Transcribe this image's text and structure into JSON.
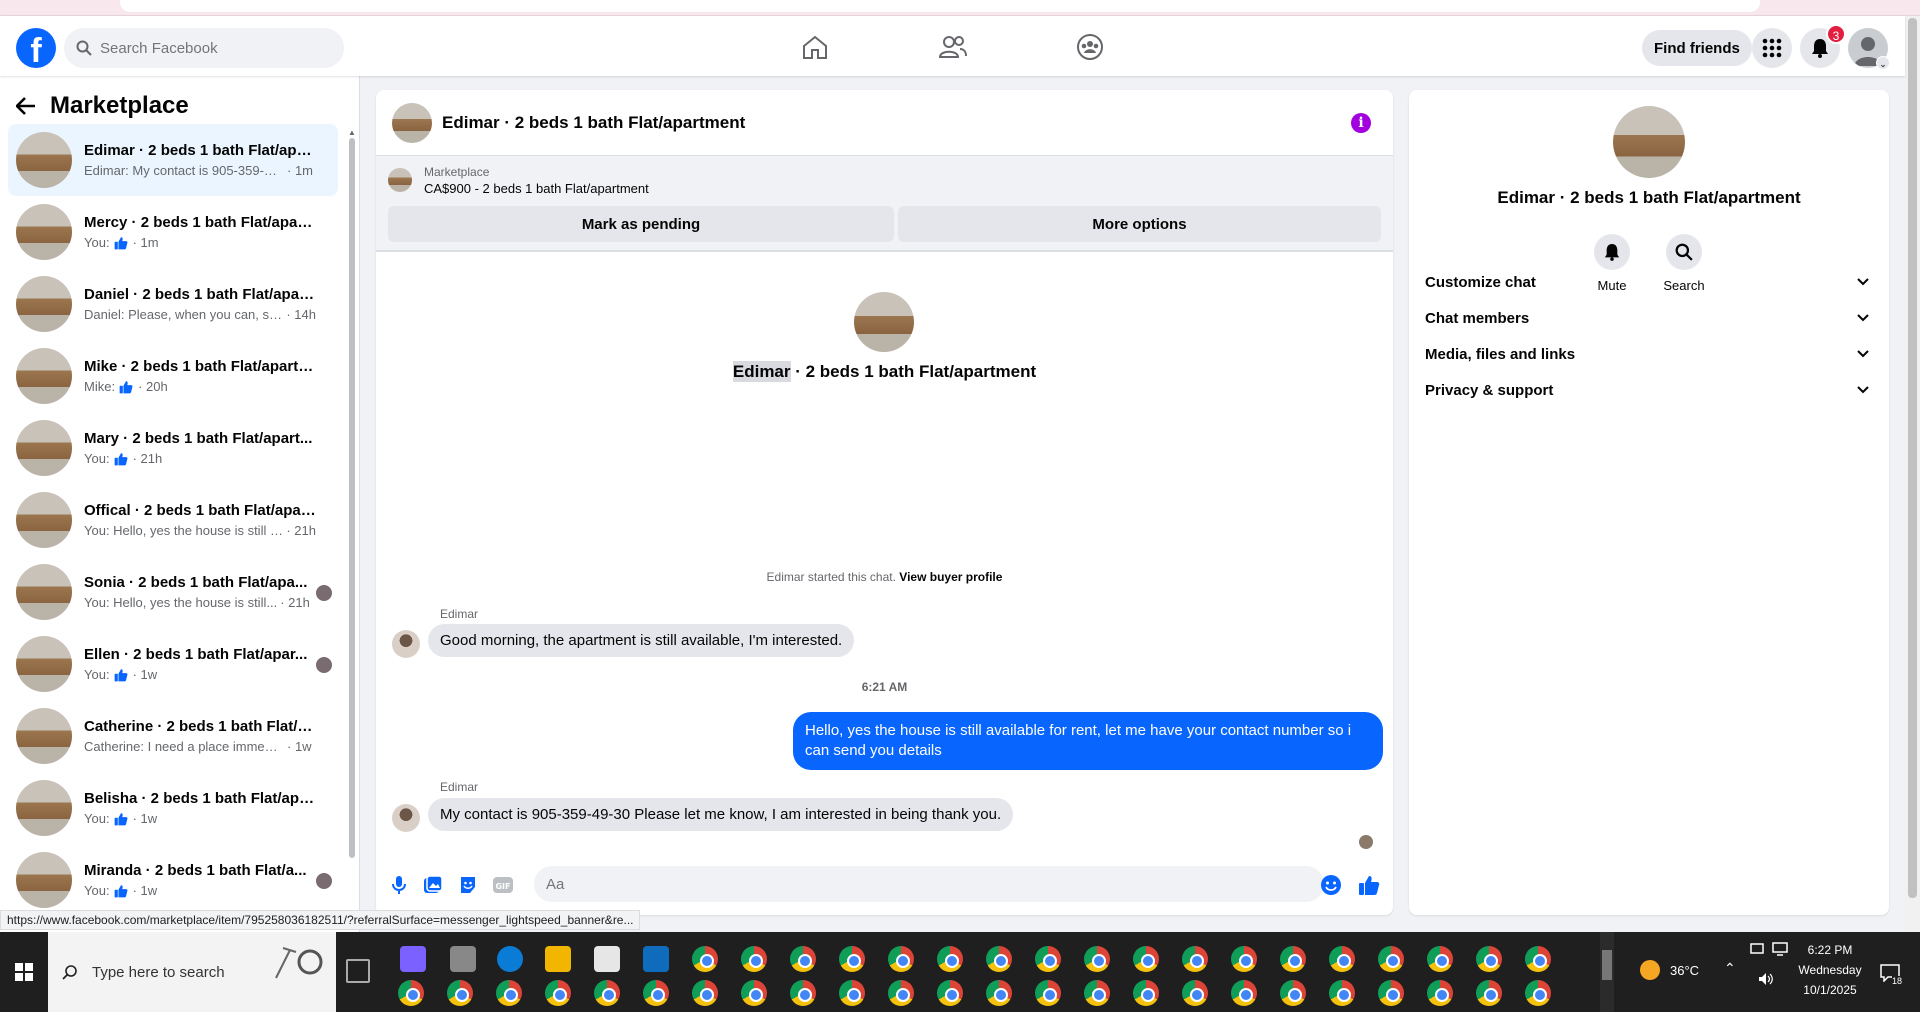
{
  "header": {
    "search_placeholder": "Search Facebook",
    "find_friends": "Find friends",
    "notifications_count": "3",
    "logo_letter": "f"
  },
  "sidebar": {
    "title": "Marketplace",
    "conversations": [
      {
        "title": "Edimar · 2 beds 1 bath Flat/apart...",
        "preview": "Edimar: My contact is 905-359-49-...",
        "time": "· 1m",
        "like": false,
        "active": true,
        "avatar": false
      },
      {
        "title": "Mercy · 2 beds 1 bath Flat/apart...",
        "preview": "You:",
        "time": "· 1m",
        "like": true,
        "active": false,
        "avatar": false
      },
      {
        "title": "Daniel · 2 beds 1 bath Flat/apart...",
        "preview": "Daniel: Please, when you can, sen...",
        "time": "· 14h",
        "like": false,
        "active": false,
        "avatar": false
      },
      {
        "title": "Mike · 2 beds 1 bath Flat/apartm...",
        "preview": "Mike:",
        "time": "· 20h",
        "like": true,
        "active": false,
        "avatar": false
      },
      {
        "title": "Mary · 2 beds 1 bath Flat/apart...",
        "preview": "You:",
        "time": "· 21h",
        "like": true,
        "active": false,
        "avatar": false
      },
      {
        "title": "Offical · 2 beds 1 bath Flat/apart...",
        "preview": "You: Hello, yes the house is still av...",
        "time": "· 21h",
        "like": false,
        "active": false,
        "avatar": false
      },
      {
        "title": "Sonia · 2 beds 1 bath Flat/apa...",
        "preview": "You: Hello, yes the house is still...",
        "time": "· 21h",
        "like": false,
        "active": false,
        "avatar": true
      },
      {
        "title": "Ellen · 2 beds 1 bath Flat/apar...",
        "preview": "You:",
        "time": "· 1w",
        "like": true,
        "active": false,
        "avatar": true
      },
      {
        "title": "Catherine · 2 beds 1 bath Flat/ap...",
        "preview": "Catherine: I need a place immediate",
        "time": "· 1w",
        "like": false,
        "active": false,
        "avatar": false
      },
      {
        "title": "Belisha · 2 beds 1 bath Flat/apar...",
        "preview": "You:",
        "time": "· 1w",
        "like": true,
        "active": false,
        "avatar": false
      },
      {
        "title": "Miranda · 2 beds 1 bath Flat/a...",
        "preview": "You:",
        "time": "· 1w",
        "like": true,
        "active": false,
        "avatar": true
      }
    ]
  },
  "chat": {
    "title": "Edimar · 2 beds 1 bath Flat/apartment",
    "marketplace_label": "Marketplace",
    "listing": "CA$900 - 2 beds 1 bath Flat/apartment",
    "mark_pending": "Mark as pending",
    "more_options": "More options",
    "intro_name_highlight": "Edimar",
    "intro_name_rest": " · 2 beds 1 bath Flat/apartment",
    "started_text": "Edimar started this chat. ",
    "view_buyer": "View buyer profile",
    "sender1": "Edimar",
    "msg1": "Good morning, the apartment is still available, I'm interested.",
    "time_sep": "6:21 AM",
    "msg_out": "Hello, yes the house is still available for rent, let me have your contact number so i can send you details",
    "sender2": "Edimar",
    "msg2": "My contact is 905-359-49-30 Please let me know, I am interested in being thank you.",
    "composer_placeholder": "Aa"
  },
  "info_panel": {
    "name": "Edimar · 2 beds 1 bath Flat/apartment",
    "mute": "Mute",
    "search": "Search",
    "sections": [
      "Customize chat",
      "Chat members",
      "Media, files and links",
      "Privacy & support"
    ]
  },
  "status_url": "https://www.facebook.com/marketplace/item/795258036182511/?referralSurface=messenger_lightspeed_banner&re...",
  "taskbar": {
    "search_text": "Type here to search",
    "weather": "36°C",
    "time": "6:22 PM",
    "day": "Wednesday",
    "date": "10/1/2025",
    "notif_count": "18"
  },
  "colors": {
    "brand": "#0866ff",
    "badge": "#e41e3f",
    "info": "#a300e0"
  }
}
